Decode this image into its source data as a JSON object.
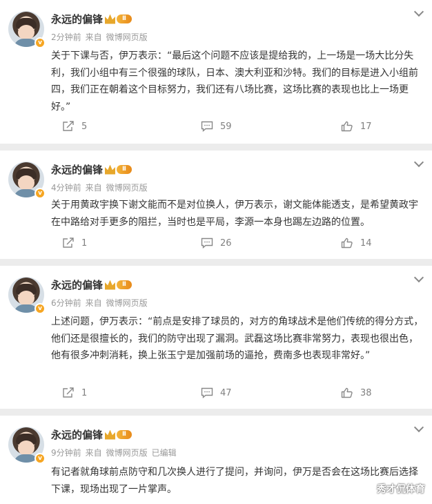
{
  "posts": [
    {
      "author": "永远的偏锋",
      "level": "Ⅱ",
      "time": "2分钟前",
      "from": "来自",
      "source": "微博网页版",
      "edited": "",
      "text": "关于下课与否，伊万表示：“最后这个问题不应该是提给我的，上一场是一场大比分失利，我们小组中有三个很强的球队，日本、澳大利亚和沙特。我们的目标是进入小组前四，我们正在朝着这个目标努力，我们还有八场比赛，这场比赛的表现也比上一场更好。”",
      "reposts": "5",
      "comments": "59",
      "likes": "17"
    },
    {
      "author": "永远的偏锋",
      "level": "Ⅱ",
      "time": "4分钟前",
      "from": "来自",
      "source": "微博网页版",
      "edited": "",
      "text": "关于用黄政宇换下谢文能而不是对位换人，伊万表示，谢文能体能透支，是希望黄政宇在中路给对手更多的阻拦，当时也是平局，李源一本身也踢左边路的位置。",
      "reposts": "1",
      "comments": "26",
      "likes": "14"
    },
    {
      "author": "永远的偏锋",
      "level": "Ⅱ",
      "time": "6分钟前",
      "from": "来自",
      "source": "微博网页版",
      "edited": "",
      "text": "上述问题，伊万表示：“前点是安排了球员的，对方的角球战术是他们传统的得分方式，他们还是很擅长的，我们的防守出现了漏洞。武磊这场比赛非常努力，表现也很出色，他有很多冲刺消耗，换上张玉宁是加强前场的逼抢，费南多也表现非常好。”",
      "reposts": "1",
      "comments": "47",
      "likes": "38"
    },
    {
      "author": "永远的偏锋",
      "level": "Ⅱ",
      "time": "9分钟前",
      "from": "来自",
      "source": "微博网页版",
      "edited": "已编辑",
      "text": "有记者就角球前点防守和几次换人进行了提问，并询问，伊万是否会在这场比赛后选择下课，现场出现了一片掌声。",
      "reposts": "",
      "comments": "",
      "likes": ""
    }
  ],
  "watermark": "秀才侃体育",
  "colors": {
    "background": "#ececec",
    "card": "#ffffff",
    "text": "#333333",
    "meta": "#999999",
    "badge": "#f6a623"
  },
  "icons": {
    "repost": "repost-icon",
    "comment": "comment-icon",
    "like": "like-icon",
    "more": "chevron-down-icon",
    "verified": "verified-badge-icon",
    "level": "crown-icon"
  }
}
